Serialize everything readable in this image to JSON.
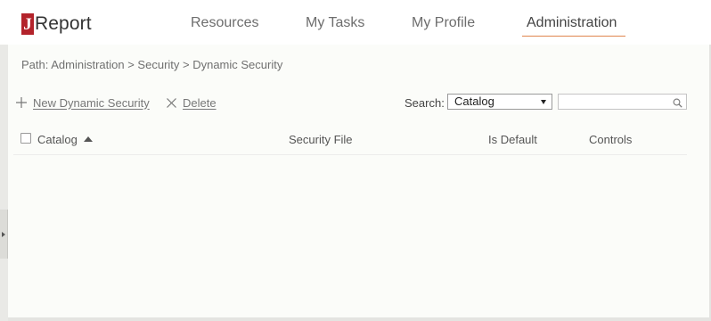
{
  "app": {
    "logo_mark": "J",
    "logo_text": "Report"
  },
  "nav": {
    "resources": "Resources",
    "my_tasks": "My Tasks",
    "my_profile": "My Profile",
    "administration": "Administration",
    "active": "Administration"
  },
  "breadcrumb": "Path: Administration > Security > Dynamic Security",
  "toolbar": {
    "new_label": "New Dynamic Security",
    "delete_label": "Delete"
  },
  "search": {
    "label": "Search:",
    "selected_option": "Catalog",
    "input_value": "",
    "input_placeholder": ""
  },
  "table": {
    "columns": {
      "catalog": "Catalog",
      "security_file": "Security File",
      "is_default": "Is Default",
      "controls": "Controls"
    },
    "sort_column": "Catalog",
    "sort_direction": "ascending",
    "rows": []
  },
  "colors": {
    "brand_red": "#b3232b",
    "nav_active_underline": "#e0854e",
    "content_bg": "#fbfcf9"
  },
  "icons": {
    "new": "plus-icon",
    "delete": "x-icon",
    "search": "search-icon",
    "sort": "sort-ascending-icon",
    "collapse": "expand-arrow-icon"
  }
}
